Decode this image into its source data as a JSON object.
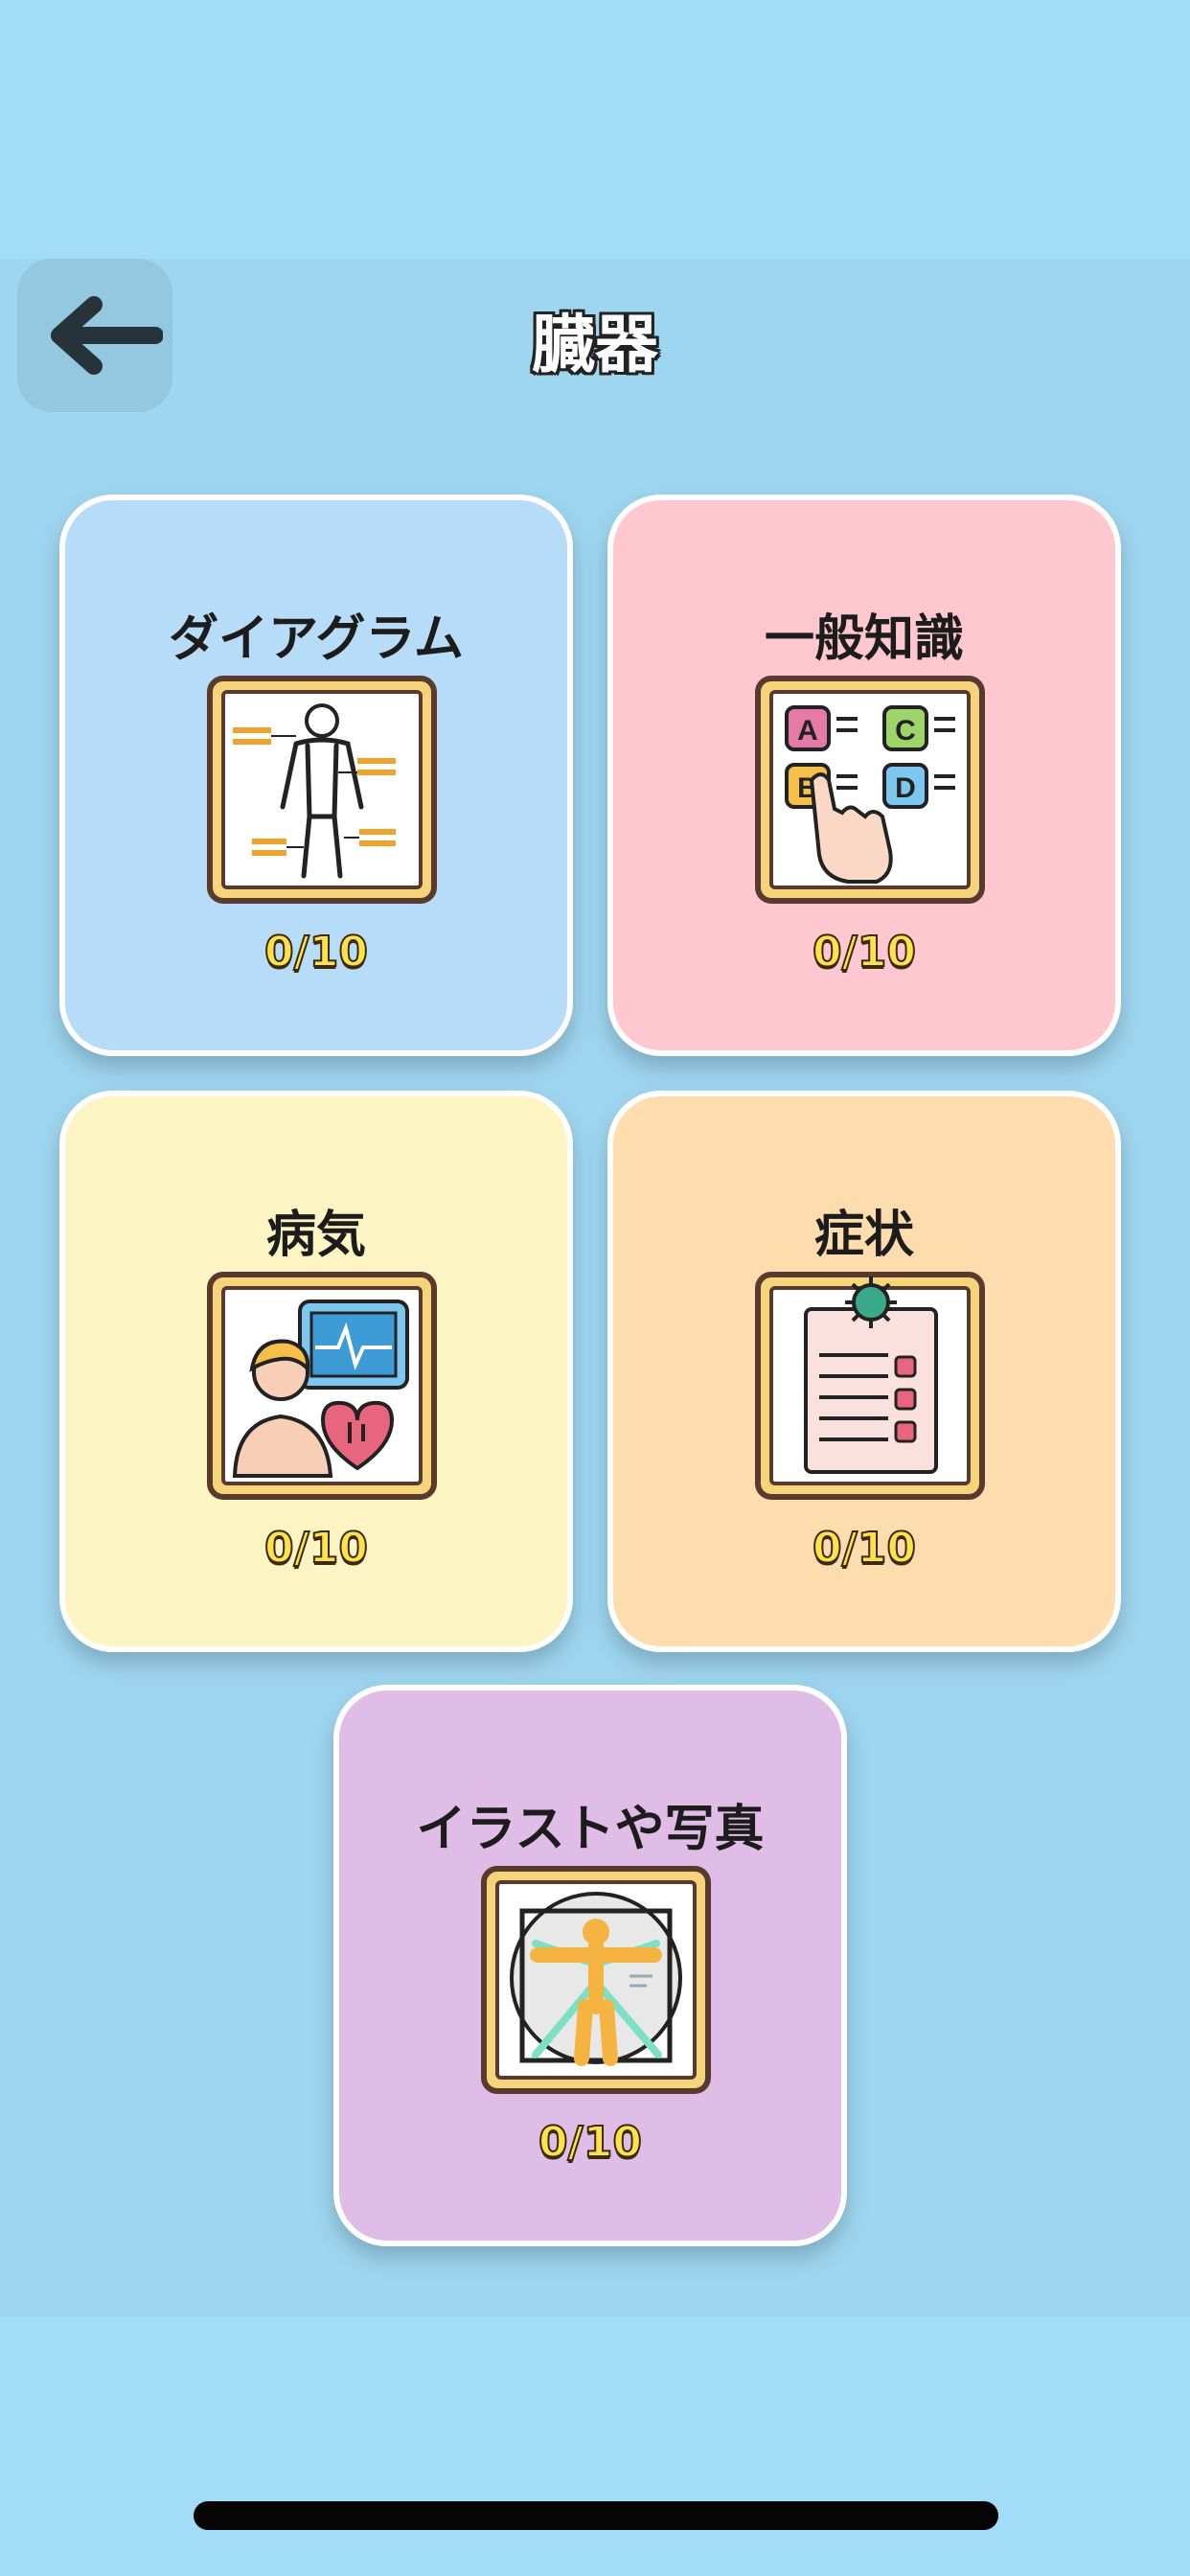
{
  "header": {
    "title": "臓器",
    "back_icon": "arrow-left-icon"
  },
  "cards": [
    {
      "label": "ダイアグラム",
      "score": "0/10",
      "color": "#b7dcf8",
      "icon": "body-diagram-icon"
    },
    {
      "label": "一般知識",
      "score": "0/10",
      "color": "#ffc7cf",
      "icon": "quiz-choices-icon"
    },
    {
      "label": "病気",
      "score": "0/10",
      "color": "#fdf4c3",
      "icon": "patient-heart-monitor-icon"
    },
    {
      "label": "症状",
      "score": "0/10",
      "color": "#fddcad",
      "icon": "virus-checklist-icon"
    },
    {
      "label": "イラストや写真",
      "score": "0/10",
      "color": "#e0bde6",
      "icon": "vitruvian-man-icon"
    }
  ]
}
